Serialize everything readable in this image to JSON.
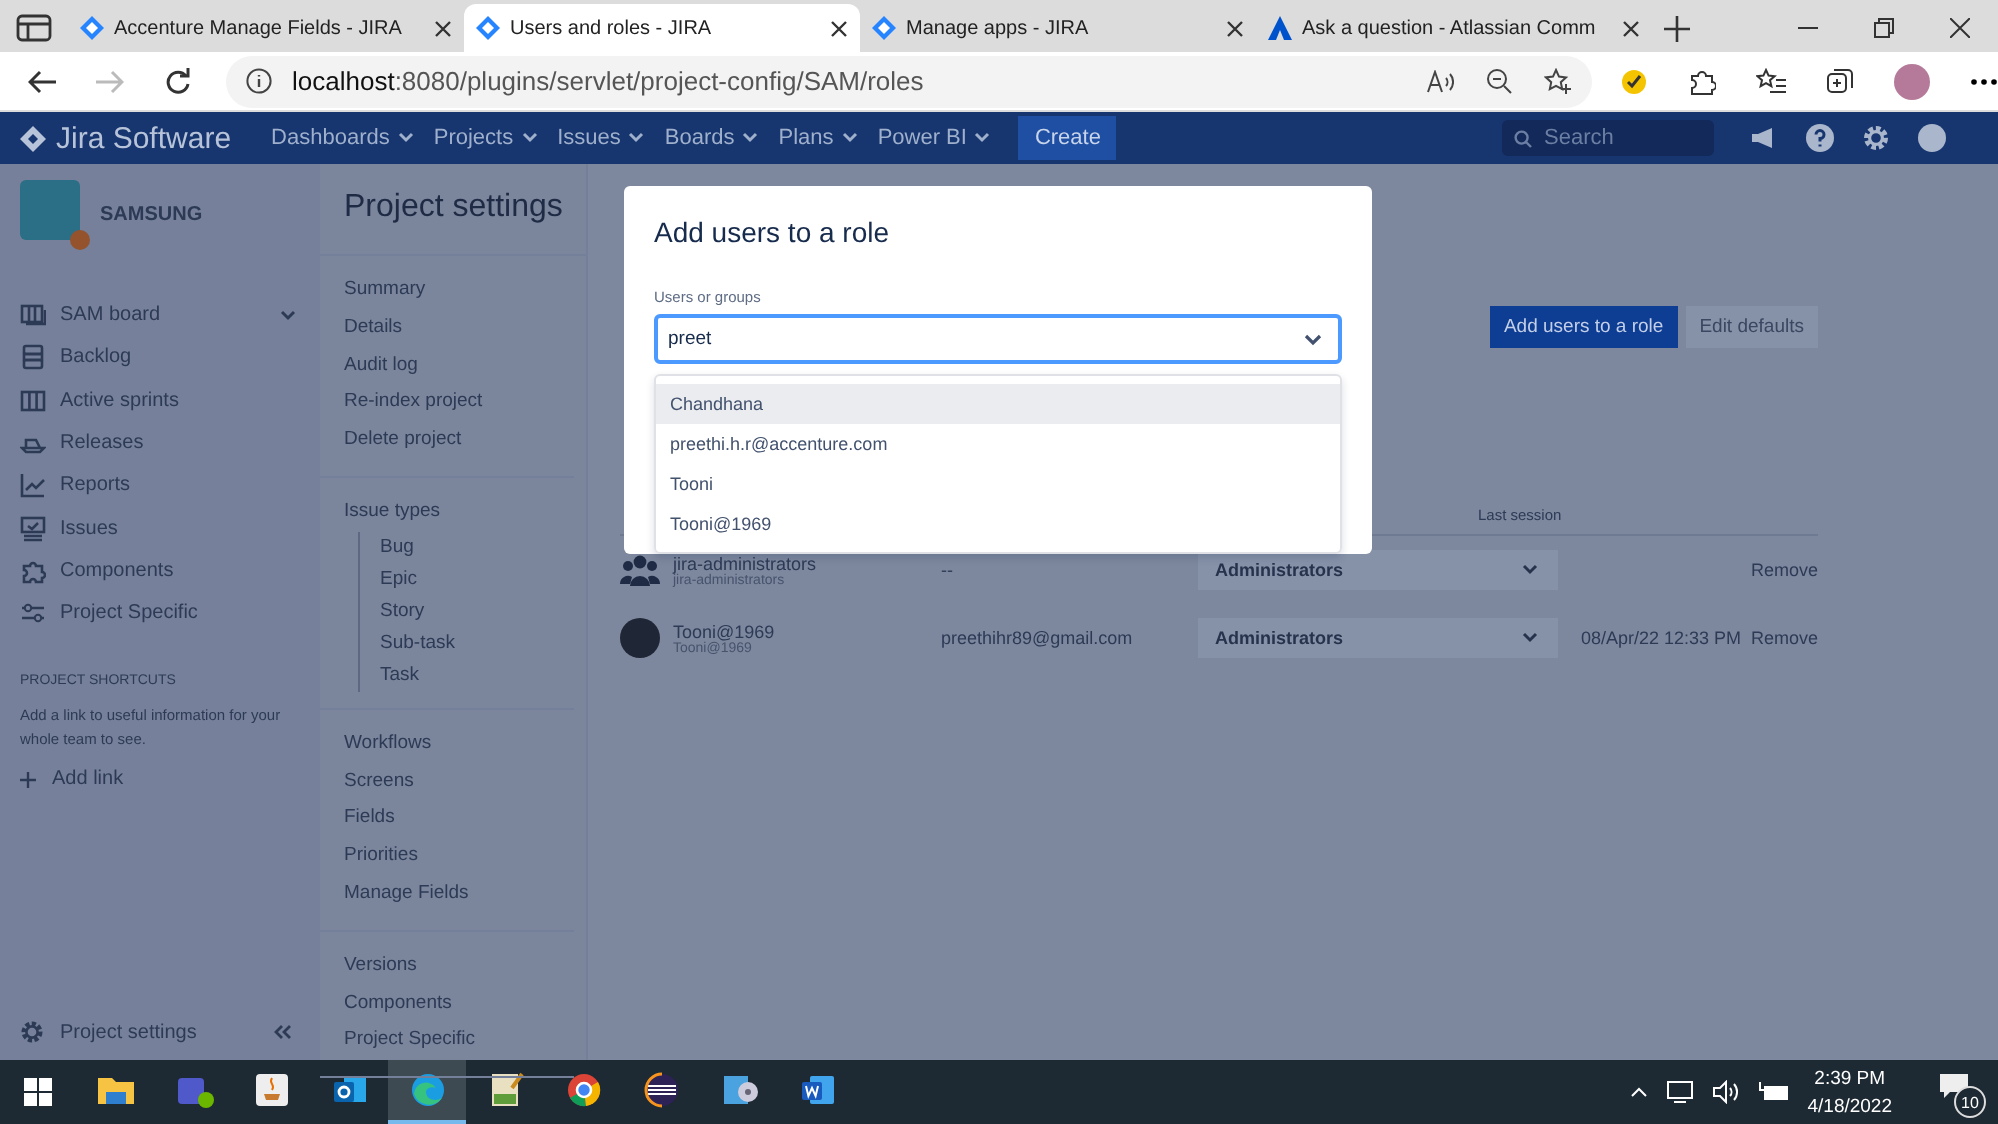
{
  "browser": {
    "tabs": [
      {
        "title": "Accenture Manage Fields - JIRA",
        "selected": false
      },
      {
        "title": "Users and roles - JIRA",
        "selected": true
      },
      {
        "title": "Manage apps - JIRA",
        "selected": false
      },
      {
        "title": "Ask a question - Atlassian Comm",
        "selected": false
      }
    ],
    "url_host": "localhost",
    "url_path": ":8080/plugins/servlet/project-config/SAM/roles"
  },
  "header": {
    "logo": "Jira Software",
    "menus": [
      "Dashboards",
      "Projects",
      "Issues",
      "Boards",
      "Plans",
      "Power BI"
    ],
    "create": "Create",
    "search": {
      "placeholder": "Search"
    }
  },
  "sidebar": {
    "project": "SAMSUNG",
    "items": [
      {
        "label": "SAM board",
        "expandable": true
      },
      {
        "label": "Backlog",
        "expandable": false
      },
      {
        "label": "Active sprints",
        "expandable": false
      },
      {
        "label": "Releases",
        "expandable": false
      },
      {
        "label": "Reports",
        "expandable": false
      },
      {
        "label": "Issues",
        "expandable": false
      },
      {
        "label": "Components",
        "expandable": false
      },
      {
        "label": "Project Specific",
        "expandable": false
      }
    ],
    "shortcuts_title": "PROJECT SHORTCUTS",
    "shortcuts_text": "Add a link to useful information for your whole team to see.",
    "add_link": "Add link",
    "footer": "Project settings"
  },
  "settings_nav": {
    "title": "Project settings",
    "groups": [
      [
        {
          "label": "Summary"
        },
        {
          "label": "Details"
        },
        {
          "label": "Audit log"
        },
        {
          "label": "Re-index project"
        },
        {
          "label": "Delete project"
        }
      ],
      [
        {
          "label": "Issue types",
          "children": [
            {
              "label": "Bug"
            },
            {
              "label": "Epic"
            },
            {
              "label": "Story"
            },
            {
              "label": "Sub-task"
            },
            {
              "label": "Task"
            }
          ]
        }
      ],
      [
        {
          "label": "Workflows"
        },
        {
          "label": "Screens"
        },
        {
          "label": "Fields"
        },
        {
          "label": "Priorities"
        },
        {
          "label": "Manage Fields"
        }
      ],
      [
        {
          "label": "Versions"
        },
        {
          "label": "Components"
        },
        {
          "label": "Project Specific"
        }
      ]
    ]
  },
  "main": {
    "buttons": [
      "Add users to a role",
      "Edit defaults"
    ],
    "last_session_header": "Last session",
    "rows": [
      {
        "kind": "group",
        "name": "jira-administrators",
        "sub": "jira-administrators",
        "email": "--",
        "role": "Administrators",
        "last_session": "",
        "action": "Remove"
      },
      {
        "kind": "user",
        "name": "Tooni@1969",
        "sub": "Tooni@1969",
        "email": "preethihr89@gmail.com",
        "role": "Administrators",
        "last_session": "08/Apr/22 12:33 PM",
        "action": "Remove"
      }
    ]
  },
  "modal": {
    "title": "Add users to a role",
    "field_label": "Users or groups",
    "value": "preet",
    "options": [
      {
        "label": "Chandhana",
        "selected": true
      },
      {
        "label": "preethi.h.r@accenture.com",
        "selected": false
      },
      {
        "label": "Tooni",
        "selected": false
      },
      {
        "label": "Tooni@1969",
        "selected": false
      }
    ]
  },
  "taskbar": {
    "apps": [
      {
        "kind": "folder",
        "selected": false
      },
      {
        "kind": "teams",
        "selected": false
      },
      {
        "kind": "java",
        "selected": false
      },
      {
        "kind": "outlook",
        "selected": false
      },
      {
        "kind": "edge",
        "selected": true
      },
      {
        "kind": "notepad",
        "selected": false
      },
      {
        "kind": "chrome",
        "selected": false
      },
      {
        "kind": "eclipse",
        "selected": false
      },
      {
        "kind": "disc",
        "selected": false
      },
      {
        "kind": "word",
        "selected": false
      }
    ],
    "time": "2:39 PM",
    "date": "4/18/2022",
    "notifications": "10"
  }
}
